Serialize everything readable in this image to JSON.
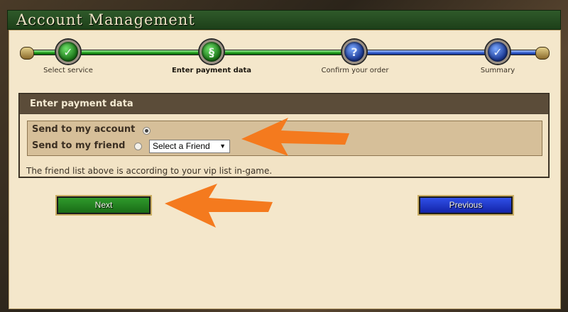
{
  "header": {
    "title": "Account Management"
  },
  "steps": [
    {
      "label": "Select service",
      "icon": "scroll-check-icon",
      "state": "done"
    },
    {
      "label": "Enter payment data",
      "icon": "scroll-icon",
      "state": "current"
    },
    {
      "label": "Confirm your order",
      "icon": "question-scroll-icon",
      "state": "pending"
    },
    {
      "label": "Summary",
      "icon": "checkmark-icon",
      "state": "pending"
    }
  ],
  "payment": {
    "heading": "Enter payment data",
    "options": [
      {
        "label": "Send to my account",
        "selected": true
      },
      {
        "label": "Send to my friend",
        "selected": false
      }
    ],
    "friend_select": {
      "value": "Select a Friend"
    },
    "note": "The friend list above is according to your vip list in-game."
  },
  "buttons": {
    "next": "Next",
    "previous": "Previous"
  },
  "colors": {
    "progress_done": "#1c9a18",
    "progress_pending": "#2d58c9",
    "annotation_arrow": "#f47a1e"
  }
}
